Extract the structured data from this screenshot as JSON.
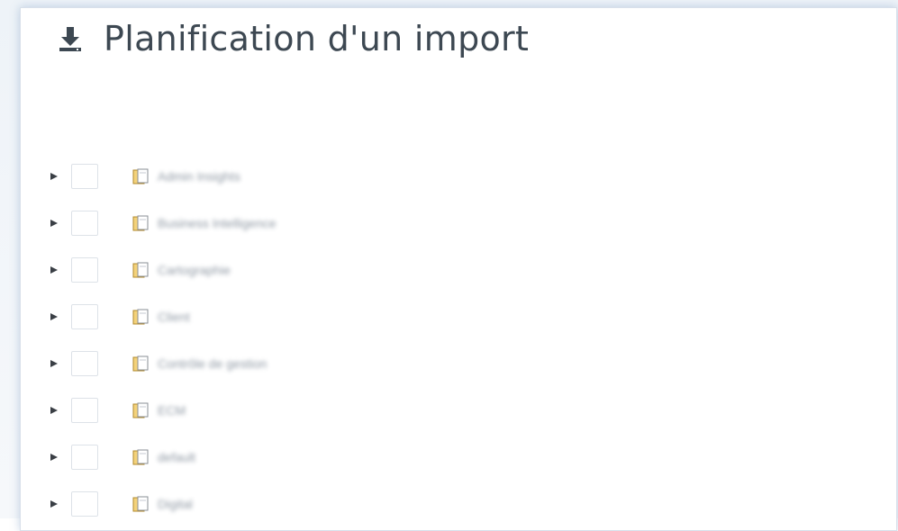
{
  "header": {
    "icon": "download-icon",
    "title": "Planification d'un import"
  },
  "tree": {
    "items": [
      {
        "label": "Admin Insights",
        "expand_icon": "caret-right-icon",
        "folder_icon": "folder-icon"
      },
      {
        "label": "Business Intelligence",
        "expand_icon": "caret-right-icon",
        "folder_icon": "folder-icon"
      },
      {
        "label": "Cartographie",
        "expand_icon": "caret-right-icon",
        "folder_icon": "folder-icon"
      },
      {
        "label": "Client",
        "expand_icon": "caret-right-icon",
        "folder_icon": "folder-icon"
      },
      {
        "label": "Contrôle de gestion",
        "expand_icon": "caret-right-icon",
        "folder_icon": "folder-icon"
      },
      {
        "label": "ECM",
        "expand_icon": "caret-right-icon",
        "folder_icon": "folder-icon"
      },
      {
        "label": "default",
        "expand_icon": "caret-right-icon",
        "folder_icon": "folder-icon"
      },
      {
        "label": "Digital",
        "expand_icon": "caret-right-icon",
        "folder_icon": "folder-icon"
      }
    ]
  },
  "colors": {
    "title_text": "#3d4852",
    "folder_fill": "#f4d27a",
    "folder_stroke": "#b08a2e",
    "checkbox_border": "#dde2e8",
    "caret": "#3a3f45"
  }
}
